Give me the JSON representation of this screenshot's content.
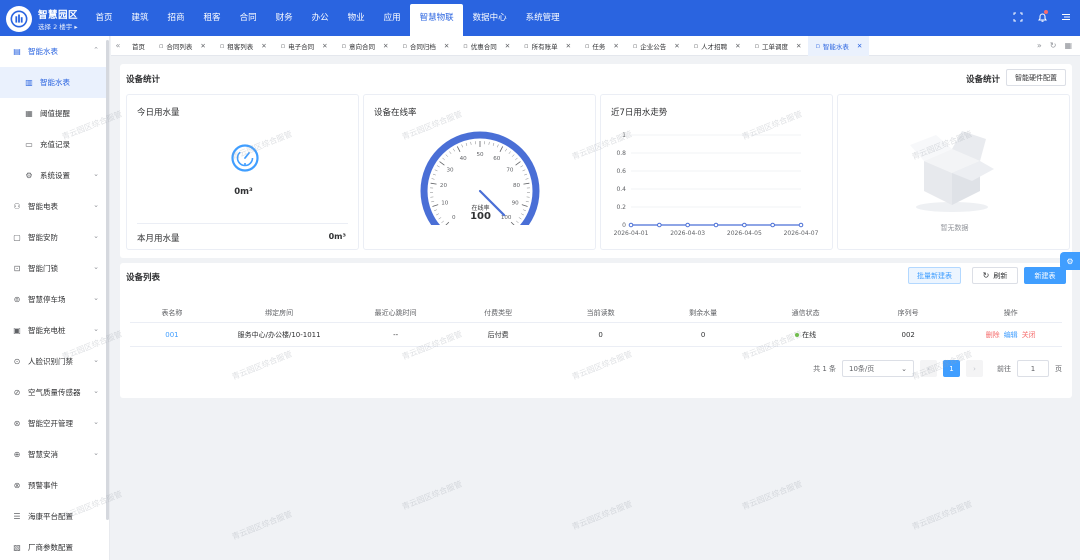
{
  "header": {
    "brand": "智慧园区",
    "building_selector": "选择 2 楼宇 ▸",
    "nav": [
      "首页",
      "建筑",
      "招商",
      "租客",
      "合同",
      "财务",
      "办公",
      "物业",
      "应用",
      "智慧物联",
      "数据中心",
      "系统管理"
    ],
    "active_nav": "智慧物联",
    "icons": [
      "fullscreen-icon",
      "bell-icon",
      "menu-icon"
    ]
  },
  "sidebar": {
    "items": [
      {
        "label": "智能水表",
        "icon": "water-meter-icon",
        "level": 0,
        "expanded": true
      },
      {
        "label": "智能水表",
        "icon": "document-icon",
        "level": 1,
        "active": true
      },
      {
        "label": "阈值提醒",
        "icon": "threshold-icon",
        "level": 1
      },
      {
        "label": "充值记录",
        "icon": "folder-icon",
        "level": 1
      },
      {
        "label": "系统设置",
        "icon": "gear-icon",
        "level": 1,
        "chevron": true
      },
      {
        "label": "智能电表",
        "icon": "plug-icon",
        "level": 0,
        "chevron": true
      },
      {
        "label": "智能安防",
        "icon": "camera-icon",
        "level": 0,
        "chevron": true
      },
      {
        "label": "智能门锁",
        "icon": "lock-icon",
        "level": 0,
        "chevron": true
      },
      {
        "label": "智慧停车场",
        "icon": "parking-icon",
        "level": 0,
        "chevron": true
      },
      {
        "label": "智能充电桩",
        "icon": "charger-icon",
        "level": 0,
        "chevron": true
      },
      {
        "label": "人脸识别门禁",
        "icon": "face-icon",
        "level": 0,
        "chevron": true
      },
      {
        "label": "空气质量传感器",
        "icon": "air-icon",
        "level": 0,
        "chevron": true
      },
      {
        "label": "智能空开管理",
        "icon": "switch-icon",
        "level": 0,
        "chevron": true
      },
      {
        "label": "智慧安消",
        "icon": "fire-icon",
        "level": 0,
        "chevron": true
      },
      {
        "label": "预警事件",
        "icon": "alert-icon",
        "level": 0
      },
      {
        "label": "海康平台配置",
        "icon": "platform-icon",
        "level": 0
      },
      {
        "label": "厂商参数配置",
        "icon": "config-icon",
        "level": 0
      }
    ]
  },
  "tabs": [
    {
      "label": "首页",
      "icon": ""
    },
    {
      "label": "合同列表",
      "icon": "doc-icon"
    },
    {
      "label": "租客列表",
      "icon": "user-icon"
    },
    {
      "label": "电子合同",
      "icon": "print-icon"
    },
    {
      "label": "意向合同",
      "icon": "pin-icon"
    },
    {
      "label": "合同归档",
      "icon": "archive-icon"
    },
    {
      "label": "优惠合同",
      "icon": "pin-icon"
    },
    {
      "label": "所有账单",
      "icon": "bill-icon"
    },
    {
      "label": "任务",
      "icon": "task-icon"
    },
    {
      "label": "企业公告",
      "icon": "bell-icon"
    },
    {
      "label": "人才招聘",
      "icon": "recruit-icon"
    },
    {
      "label": "工单调度",
      "icon": "dispatch-icon"
    },
    {
      "label": "智能水表",
      "icon": "doc-icon",
      "active": true
    }
  ],
  "stats": {
    "title": "设备统计",
    "right_title": "设备统计",
    "config_button": "智能硬件配置",
    "water": {
      "title": "今日用水量",
      "today_value": "0m³",
      "month_label": "本月用水量",
      "month_value": "0m³"
    },
    "online": {
      "title": "设备在线率",
      "gauge_label": "在线率",
      "gauge_value": "100",
      "ticks": [
        "0",
        "10",
        "20",
        "30",
        "40",
        "50",
        "60",
        "70",
        "80",
        "90",
        "100"
      ],
      "value_percent": 100
    },
    "trend": {
      "title": "近7日用水走势"
    },
    "empty_text": "暂无数据"
  },
  "chart_data": {
    "type": "line",
    "title": "近7日用水走势",
    "x": [
      "2026-04-01",
      "2026-04-02",
      "2026-04-03",
      "2026-04-04",
      "2026-04-05",
      "2026-04-06",
      "2026-04-07"
    ],
    "x_tick_labels": [
      "2026-04-01",
      "2026-04-03",
      "2026-04-05",
      "2026-04-07"
    ],
    "series": [
      {
        "values": [
          0,
          0,
          0,
          0,
          0,
          0,
          0
        ],
        "color": "#4a6fd6"
      }
    ],
    "y_ticks": [
      "0",
      "0.2",
      "0.4",
      "0.6",
      "0.8",
      "1"
    ],
    "ylim": [
      0,
      1
    ],
    "grid": true
  },
  "device_list": {
    "title": "设备列表",
    "batch_button": "批量新建表",
    "refresh_button": "刷新",
    "new_button": "新建表",
    "columns": [
      "表名称",
      "绑定房间",
      "最近心跳时间",
      "付费类型",
      "当前读数",
      "剩余水量",
      "通信状态",
      "序列号",
      "操作"
    ],
    "rows": [
      {
        "name": "001",
        "room": "服务中心/办公楼/10-1011",
        "heartbeat": "--",
        "pay_type": "后付费",
        "reading": "0",
        "remaining": "0",
        "status": "在线",
        "serial": "002",
        "actions": [
          "删除",
          "编辑",
          "关闭"
        ]
      }
    ],
    "pagination": {
      "total": "共 1 条",
      "page_size": "10条/页",
      "current": "1",
      "goto_label": "前往",
      "goto_value": "1",
      "page_suffix": "页"
    }
  },
  "watermark": "青云园区综合服管",
  "colors": {
    "primary": "#2a64e0",
    "online": "#67c23a",
    "danger": "#f56c6c",
    "link": "#409eff",
    "gauge": "#4a6fd6"
  }
}
